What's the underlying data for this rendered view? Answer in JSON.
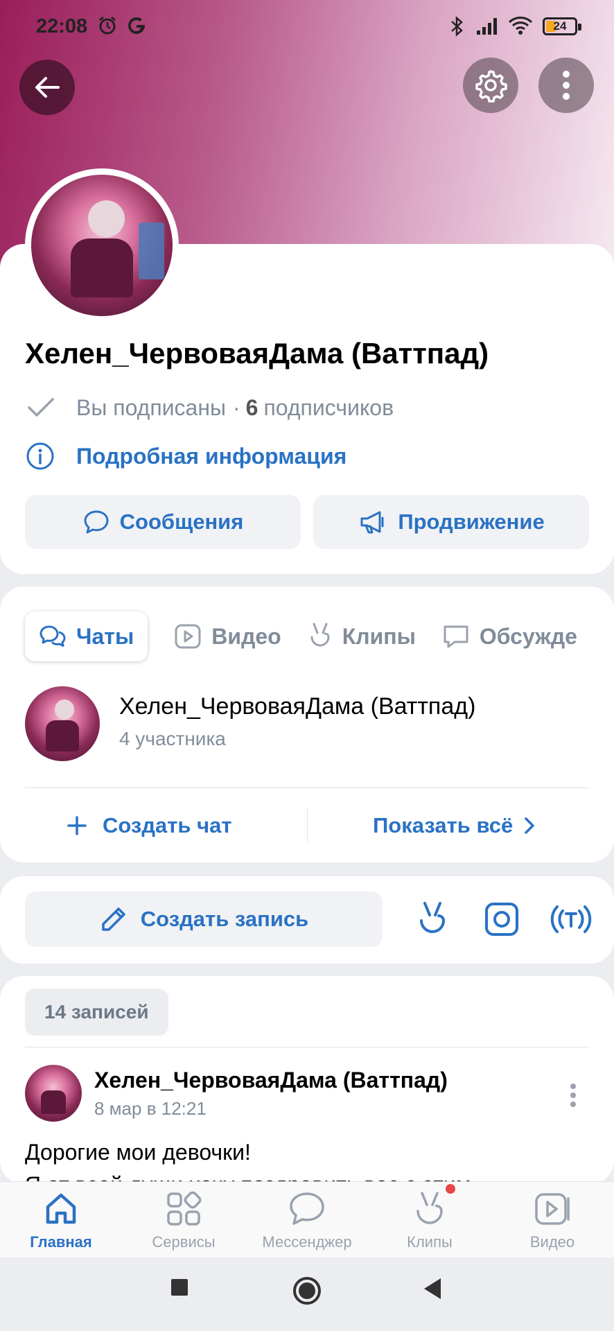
{
  "status_bar": {
    "time": "22:08",
    "battery_level": "24"
  },
  "header": {
    "back_icon": "arrow-left-icon",
    "settings_icon": "gear-icon",
    "more_icon": "more-vertical-icon"
  },
  "profile": {
    "name": "Хелен_ЧервоваяДама (Ваттпад)",
    "subscribed_label": "Вы подписаны",
    "separator": "·",
    "subscriber_count": "6",
    "subscribers_label": "подписчиков",
    "details_link": "Подробная информация",
    "messages_button": "Сообщения",
    "promotion_button": "Продвижение"
  },
  "sections": {
    "tabs": [
      {
        "label": "Чаты",
        "icon": "chats-icon",
        "active": true
      },
      {
        "label": "Видео",
        "icon": "video-icon",
        "active": false
      },
      {
        "label": "Клипы",
        "icon": "clips-icon",
        "active": false
      },
      {
        "label": "Обсужде",
        "icon": "discussion-icon",
        "active": false
      }
    ],
    "chat": {
      "title": "Хелен_ЧервоваяДама (Ваттпад)",
      "members": "4 участника"
    },
    "create_chat": "Создать чат",
    "show_all": "Показать всё"
  },
  "composer": {
    "create_post": "Создать запись",
    "quick_icons": [
      "clips-icon",
      "instagram-style-camera-icon",
      "live-stream-icon"
    ]
  },
  "wall": {
    "posts_count": "14 записей",
    "post": {
      "author": "Хелен_ЧервоваяДама (Ваттпад)",
      "date": "8 мар в 12:21",
      "text_line1": "Дорогие мои девочки!",
      "text_line2": "Я от всей души хочу поздравить вас с этим"
    }
  },
  "bottom_nav": {
    "items": [
      {
        "label": "Главная",
        "icon": "home-icon",
        "active": true
      },
      {
        "label": "Сервисы",
        "icon": "services-grid-icon",
        "active": false
      },
      {
        "label": "Мессенджер",
        "icon": "messenger-icon",
        "active": false
      },
      {
        "label": "Клипы",
        "icon": "clips-icon",
        "active": false,
        "badge": true
      },
      {
        "label": "Видео",
        "icon": "video-icon",
        "active": false
      }
    ]
  },
  "colors": {
    "accent": "#2a72c4",
    "secondary_text": "#818c99",
    "badge": "#e64646",
    "cover_start": "#9a1d5a",
    "cover_end": "#f6e9f1"
  }
}
